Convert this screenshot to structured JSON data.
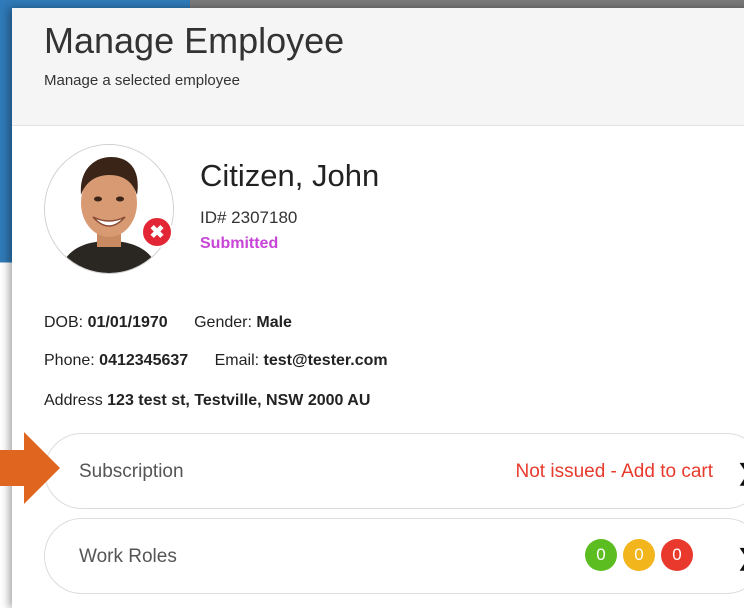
{
  "modal": {
    "title": "Manage Employee",
    "subtitle": "Manage a selected employee"
  },
  "employee": {
    "name": "Citizen, John",
    "id": "ID# 2307180",
    "status": "Submitted",
    "dob_label": "DOB:",
    "dob": "01/01/1970",
    "gender_label": "Gender:",
    "gender": "Male",
    "phone_label": "Phone:",
    "phone": "0412345637",
    "email_label": "Email:",
    "email": "test@tester.com",
    "address_label": "Address",
    "address": "123 test st, Testville, NSW 2000 AU"
  },
  "rows": {
    "subscription": {
      "label": "Subscription",
      "value": "Not issued - Add to cart"
    },
    "work_roles": {
      "label": "Work Roles",
      "badges": [
        {
          "value": "0",
          "color": "#5cbd20"
        },
        {
          "value": "0",
          "color": "#f2b51c"
        },
        {
          "value": "0",
          "color": "#e8392c"
        }
      ]
    }
  },
  "colors": {
    "status": "#c845d8",
    "alert": "#e83a2c",
    "arrow": "#e0651e",
    "remove_badge": "#e32636"
  },
  "icons": {
    "remove": "close-icon",
    "chevron": "chevron-right-icon",
    "annotation": "arrow-right-icon"
  }
}
